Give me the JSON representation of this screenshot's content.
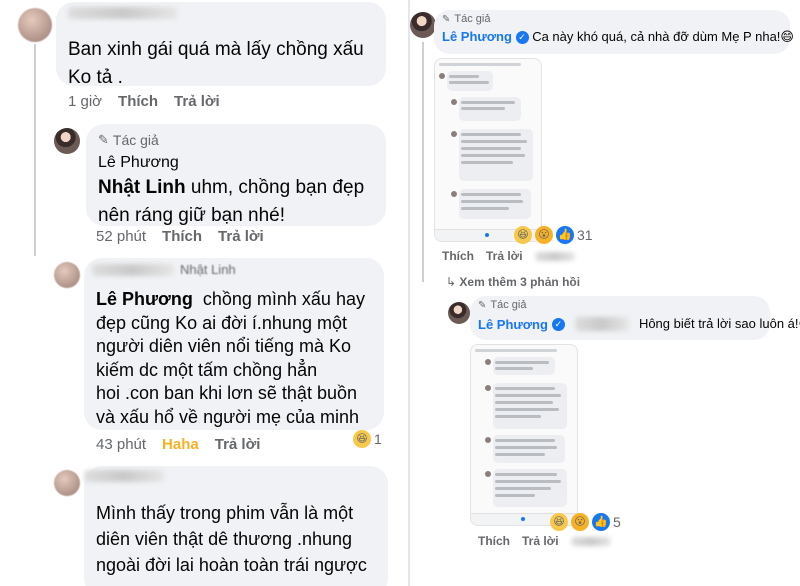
{
  "left": {
    "comment1": {
      "text_line1": "Ban xinh gái quá mà lấy chồng xấu",
      "text_line2": "Ko tả .",
      "time": "1 giờ",
      "like": "Thích",
      "reply": "Trả lời"
    },
    "reply1": {
      "author_tag": "Tác giả",
      "author": "Lê Phương",
      "mention": "Nhật Linh",
      "text_line1": "uhm, chồng bạn đẹp",
      "text_line2": "nên ráng giữ bạn nhé!",
      "time": "52 phút",
      "like": "Thích",
      "reply": "Trả lời"
    },
    "comment2": {
      "header_partial": "Nhật Linh",
      "mention": "Lê Phương",
      "text_line1": "chồng mình xấu hay",
      "text_line2": "đẹp cũng Ko ai đời í.nhung một",
      "text_line3": "người diên viên nổi tiếng mà Ko",
      "text_line4": "kiếm dc một tấm chồng hẳn",
      "text_line5": "hoi .con ban khi lơn sẽ thật buồn",
      "text_line6": "và xấu hổ về người mẹ của minh",
      "time": "43 phút",
      "reaction": "Haha",
      "reply": "Trả lời",
      "reaction_count": "1"
    },
    "comment3": {
      "text_line1": "Mình thấy trong phim vẫn là một",
      "text_line2": "diên viên thật dê thương .nhung",
      "text_line3": "ngoài đời lai hoàn toàn trái ngược"
    }
  },
  "right": {
    "post1": {
      "author_tag": "Tác giả",
      "author": "Lê Phương",
      "text": "Ca này khó quá, cả nhà đỡ dùm Mẹ P nha!😄",
      "reaction_count": "31",
      "like": "Thích",
      "reply": "Trả lời"
    },
    "more_replies": "Xem thêm 3 phản hồi",
    "post2": {
      "author_tag": "Tác giả",
      "author": "Lê Phương",
      "text": "Hông biết trả lời sao luôn á!😄",
      "reaction_count": "5",
      "like": "Thích",
      "reply": "Trả lời"
    }
  },
  "icons": {
    "pen": "✎",
    "verified": "✓",
    "haha": "😆",
    "wow": "😮",
    "like": "👍",
    "reply_arrow": "↳"
  }
}
